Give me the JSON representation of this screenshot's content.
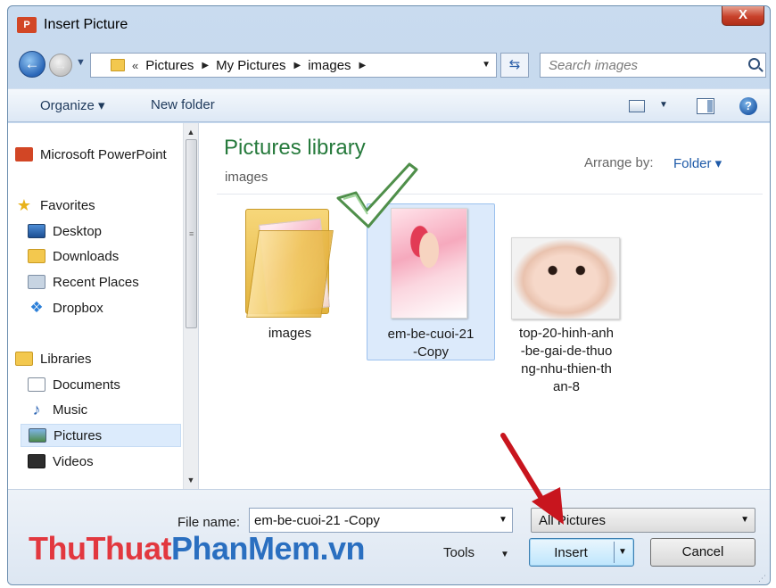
{
  "window": {
    "title": "Insert Picture",
    "app_icon": "powerpoint-icon",
    "close_label": "X"
  },
  "address": {
    "breadcrumbs": [
      "Pictures",
      "My Pictures",
      "images"
    ],
    "prefix": "«",
    "search_placeholder": "Search images"
  },
  "toolbar": {
    "organize_label": "Organize ▾",
    "new_folder_label": "New folder",
    "help_label": "?"
  },
  "navpane": {
    "items": [
      {
        "label": "Microsoft PowerPoint",
        "icon": "powerpoint-icon"
      },
      {
        "label": "Favorites",
        "icon": "star-icon"
      },
      {
        "label": "Desktop",
        "icon": "desktop-icon"
      },
      {
        "label": "Downloads",
        "icon": "downloads-folder-icon"
      },
      {
        "label": "Recent Places",
        "icon": "recent-places-icon"
      },
      {
        "label": "Dropbox",
        "icon": "dropbox-icon"
      },
      {
        "label": "Libraries",
        "icon": "libraries-icon"
      },
      {
        "label": "Documents",
        "icon": "documents-icon"
      },
      {
        "label": "Music",
        "icon": "music-icon"
      },
      {
        "label": "Pictures",
        "icon": "pictures-icon"
      },
      {
        "label": "Videos",
        "icon": "videos-icon"
      }
    ],
    "selected": "Pictures"
  },
  "content": {
    "library_title": "Pictures library",
    "library_subtitle": "images",
    "arrange_label": "Arrange by:",
    "arrange_value": "Folder ▾",
    "files": [
      {
        "name": "images",
        "type": "folder"
      },
      {
        "name": "em-be-cuoi-21 -Copy",
        "line1": "em-be-cuoi-21",
        "line2": "-Copy",
        "type": "image",
        "selected": true
      },
      {
        "name": "top-20-hinh-anh-be-gai-de-thuong-nhu-thien-than-8",
        "line1": "top-20-hinh-anh",
        "line2": "-be-gai-de-thuo",
        "line3": "ng-nhu-thien-th",
        "line4": "an-8",
        "type": "image"
      }
    ]
  },
  "footer": {
    "file_name_label": "File name:",
    "file_name_value": "em-be-cuoi-21 -Copy",
    "file_type_value": "All Pictures",
    "tools_label": "Tools",
    "insert_label": "Insert",
    "cancel_label": "Cancel"
  },
  "watermark": {
    "part1": "ThuThuat",
    "part2": "PhanMem",
    "part3": ".vn"
  },
  "colors": {
    "accent_green": "#267a3c",
    "link_blue": "#1e5aa8",
    "annotation_red": "#c8151e",
    "watermark_red": "#e2383f",
    "watermark_blue": "#2a6fc0"
  }
}
